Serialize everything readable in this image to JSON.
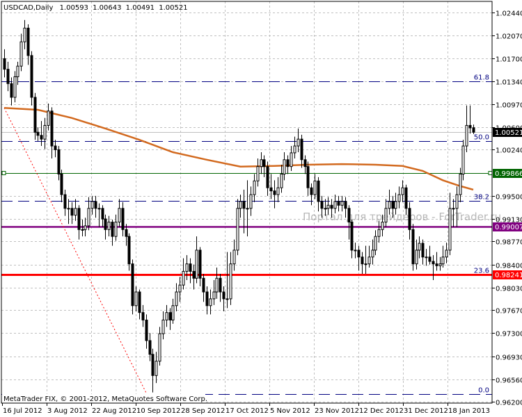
{
  "header": {
    "symbol_period": "USDCAD,Daily",
    "open": "1.00593",
    "high": "1.00643",
    "low": "1.00491",
    "close": "1.00521"
  },
  "copyright": "MetaTrader FIX, © 2001-2012, MetaQuotes Software Corp.",
  "watermark": "Портал для трейдеров - ForTrader.ru",
  "colors": {
    "background": "#ffffff",
    "grid": "#c0c0c0",
    "bull_body": "#ffffff",
    "bear_body": "#000000",
    "ma": "#d2691e",
    "fibo": "#000080",
    "trendline": "#ff0000",
    "level_green": "#006400",
    "level_purple": "#800080",
    "level_red": "#ff0000",
    "current_price": "#000000",
    "current_line": "#c0c0c0"
  },
  "chart_data": {
    "type": "candlestick",
    "title": "USDCAD,Daily",
    "ylim": [
      0.96178,
      1.02618
    ],
    "y_ticks": [
      "1.02440",
      "1.02070",
      "1.01700",
      "1.01340",
      "1.00970",
      "1.00600",
      "1.00240",
      "0.99500",
      "0.99130",
      "0.98770",
      "0.98400",
      "0.98030",
      "0.97670",
      "0.97300",
      "0.96930",
      "0.96560",
      "0.96200"
    ],
    "x_tick_labels": [
      "16 Jul 2012",
      "3 Aug 2012",
      "22 Aug 2012",
      "10 Sep 2012",
      "28 Sep 2012",
      "17 Oct 2012",
      "5 Nov 2012",
      "23 Nov 2012",
      "12 Dec 2012",
      "31 Dec 2012",
      "18 Jan 2013"
    ],
    "grid": true,
    "ohlc": [
      [
        1.017,
        1.0185,
        1.014,
        1.0153
      ],
      [
        1.0153,
        1.0165,
        1.0118,
        1.013
      ],
      [
        1.013,
        1.014,
        1.0095,
        1.0108
      ],
      [
        1.0108,
        1.015,
        1.01,
        1.0141
      ],
      [
        1.0141,
        1.0165,
        1.0128,
        1.0158
      ],
      [
        1.0158,
        1.021,
        1.015,
        1.0197
      ],
      [
        1.0197,
        1.0232,
        1.0185,
        1.0219
      ],
      [
        1.0219,
        1.0225,
        1.016,
        1.0175
      ],
      [
        1.0175,
        1.0182,
        1.0095,
        1.0108
      ],
      [
        1.0108,
        1.0115,
        1.004,
        1.0052
      ],
      [
        1.0052,
        1.006,
        1.0038,
        1.0047
      ],
      [
        1.0047,
        1.007,
        1.003,
        1.0041
      ],
      [
        1.0041,
        1.0075,
        1.0025,
        1.0063
      ],
      [
        1.0063,
        1.0098,
        1.0055,
        1.0086
      ],
      [
        1.0086,
        1.0092,
        1.001,
        1.003
      ],
      [
        1.003,
        1.004,
        1.0012,
        1.0024
      ],
      [
        1.0024,
        1.003,
        0.9975,
        0.9985
      ],
      [
        0.9985,
        0.9992,
        0.994,
        0.9952
      ],
      [
        0.9952,
        0.996,
        0.9918,
        0.993
      ],
      [
        0.993,
        0.9945,
        0.9905,
        0.993
      ],
      [
        0.993,
        0.994,
        0.9905,
        0.9919
      ],
      [
        0.9919,
        0.9945,
        0.991,
        0.993
      ],
      [
        0.993,
        0.9935,
        0.988,
        0.9896
      ],
      [
        0.9896,
        0.9912,
        0.9885,
        0.9896
      ],
      [
        0.9896,
        0.9915,
        0.9885,
        0.9902
      ],
      [
        0.9902,
        0.9948,
        0.9895,
        0.993
      ],
      [
        0.993,
        0.995,
        0.992,
        0.9941
      ],
      [
        0.9941,
        0.995,
        0.9915,
        0.993
      ],
      [
        0.993,
        0.9938,
        0.99,
        0.993
      ],
      [
        0.993,
        0.9935,
        0.99,
        0.9913
      ],
      [
        0.9913,
        0.992,
        0.988,
        0.9896
      ],
      [
        0.9896,
        0.9918,
        0.9885,
        0.9908
      ],
      [
        0.9908,
        0.9912,
        0.987,
        0.9885
      ],
      [
        0.9885,
        0.992,
        0.9878,
        0.9908
      ],
      [
        0.9908,
        0.9945,
        0.99,
        0.993
      ],
      [
        0.993,
        0.994,
        0.9885,
        0.9896
      ],
      [
        0.9896,
        0.9905,
        0.987,
        0.9885
      ],
      [
        0.9885,
        0.989,
        0.983,
        0.9841
      ],
      [
        0.9841,
        0.9848,
        0.976,
        0.9774
      ],
      [
        0.9774,
        0.9805,
        0.9765,
        0.9796
      ],
      [
        0.9796,
        0.98,
        0.9752,
        0.9763
      ],
      [
        0.9763,
        0.9775,
        0.974,
        0.9751
      ],
      [
        0.9751,
        0.976,
        0.9705,
        0.9718
      ],
      [
        0.9718,
        0.973,
        0.9685,
        0.9696
      ],
      [
        0.9696,
        0.9705,
        0.9635,
        0.9662
      ],
      [
        0.9662,
        0.97,
        0.965,
        0.9685
      ],
      [
        0.9685,
        0.974,
        0.9678,
        0.9729
      ],
      [
        0.9729,
        0.9765,
        0.972,
        0.9751
      ],
      [
        0.9751,
        0.9775,
        0.974,
        0.9763
      ],
      [
        0.9763,
        0.977,
        0.9735,
        0.9751
      ],
      [
        0.9751,
        0.9785,
        0.9745,
        0.9774
      ],
      [
        0.9774,
        0.981,
        0.9765,
        0.9796
      ],
      [
        0.9796,
        0.982,
        0.978,
        0.9807
      ],
      [
        0.9807,
        0.985,
        0.98,
        0.9829
      ],
      [
        0.9829,
        0.9855,
        0.9815,
        0.9841
      ],
      [
        0.9841,
        0.985,
        0.981,
        0.9829
      ],
      [
        0.9829,
        0.984,
        0.98,
        0.9818
      ],
      [
        0.9818,
        0.9885,
        0.981,
        0.9863
      ],
      [
        0.9863,
        0.9868,
        0.9805,
        0.9818
      ],
      [
        0.9818,
        0.9825,
        0.978,
        0.9796
      ],
      [
        0.9796,
        0.9805,
        0.976,
        0.9774
      ],
      [
        0.9774,
        0.98,
        0.976,
        0.9785
      ],
      [
        0.9785,
        0.9815,
        0.9775,
        0.9796
      ],
      [
        0.9796,
        0.9835,
        0.9785,
        0.9818
      ],
      [
        0.9818,
        0.9825,
        0.978,
        0.9796
      ],
      [
        0.9796,
        0.9805,
        0.9765,
        0.9785
      ],
      [
        0.9785,
        0.986,
        0.977,
        0.9785
      ],
      [
        0.9785,
        0.986,
        0.9775,
        0.9841
      ],
      [
        0.9841,
        0.988,
        0.983,
        0.9863
      ],
      [
        0.9863,
        0.9945,
        0.9855,
        0.993
      ],
      [
        0.993,
        0.9952,
        0.9915,
        0.9941
      ],
      [
        0.9941,
        0.996,
        0.989,
        0.993
      ],
      [
        0.993,
        0.9975,
        0.9885,
        0.993
      ],
      [
        0.993,
        0.9965,
        0.9918,
        0.9952
      ],
      [
        0.9952,
        0.9985,
        0.994,
        0.9974
      ],
      [
        0.9974,
        1.001,
        0.9965,
        0.9997
      ],
      [
        0.9997,
        1.002,
        0.9985,
        1.0008
      ],
      [
        1.0008,
        1.0015,
        0.998,
        0.9997
      ],
      [
        0.9997,
        1.0005,
        0.995,
        0.9963
      ],
      [
        0.9963,
        0.9985,
        0.9945,
        0.9958
      ],
      [
        0.9958,
        0.9975,
        0.993,
        0.9952
      ],
      [
        0.9952,
        0.998,
        0.994,
        0.9963
      ],
      [
        0.9963,
        1.0,
        0.9955,
        0.9985
      ],
      [
        0.9985,
        1.002,
        0.9975,
        1.0008
      ],
      [
        1.0008,
        1.0015,
        0.9985,
        0.9997
      ],
      [
        0.9997,
        1.003,
        0.999,
        1.0019
      ],
      [
        1.0019,
        1.0045,
        1.001,
        1.003
      ],
      [
        1.003,
        1.0058,
        1.002,
        1.0041
      ],
      [
        1.0041,
        1.0048,
        0.9995,
        1.0008
      ],
      [
        1.0008,
        1.0015,
        0.9985,
        0.9997
      ],
      [
        0.9997,
        1.0005,
        0.995,
        0.9963
      ],
      [
        0.9963,
        0.997,
        0.9935,
        0.9952
      ],
      [
        0.9952,
        0.9985,
        0.9945,
        0.9974
      ],
      [
        0.9974,
        0.998,
        0.9925,
        0.9941
      ],
      [
        0.9941,
        0.995,
        0.9915,
        0.993
      ],
      [
        0.993,
        0.9945,
        0.9918,
        0.993
      ],
      [
        0.993,
        0.9948,
        0.992,
        0.9935
      ],
      [
        0.9935,
        0.9945,
        0.9915,
        0.993
      ],
      [
        0.993,
        0.9952,
        0.9922,
        0.9941
      ],
      [
        0.9941,
        0.995,
        0.9925,
        0.9935
      ],
      [
        0.9935,
        0.995,
        0.9925,
        0.9941
      ],
      [
        0.9941,
        0.9948,
        0.9915,
        0.993
      ],
      [
        0.993,
        0.9935,
        0.988,
        0.9908
      ],
      [
        0.9908,
        0.9912,
        0.985,
        0.9863
      ],
      [
        0.9863,
        0.9875,
        0.985,
        0.9863
      ],
      [
        0.9863,
        0.987,
        0.983,
        0.9852
      ],
      [
        0.9852,
        0.986,
        0.9825,
        0.9841
      ],
      [
        0.9841,
        0.987,
        0.9825,
        0.9841
      ],
      [
        0.9841,
        0.987,
        0.9835,
        0.9852
      ],
      [
        0.9852,
        0.988,
        0.984,
        0.9863
      ],
      [
        0.9863,
        0.9895,
        0.9855,
        0.9885
      ],
      [
        0.9885,
        0.991,
        0.9875,
        0.9896
      ],
      [
        0.9896,
        0.992,
        0.9885,
        0.9908
      ],
      [
        0.9908,
        0.9945,
        0.99,
        0.993
      ],
      [
        0.993,
        0.996,
        0.992,
        0.9941
      ],
      [
        0.9941,
        0.995,
        0.9915,
        0.993
      ],
      [
        0.993,
        0.9955,
        0.992,
        0.9941
      ],
      [
        0.9941,
        0.9965,
        0.993,
        0.9952
      ],
      [
        0.9952,
        0.9975,
        0.994,
        0.9963
      ],
      [
        0.9963,
        0.9968,
        0.992,
        0.993
      ],
      [
        0.993,
        0.994,
        0.988,
        0.9896
      ],
      [
        0.9896,
        0.9905,
        0.983,
        0.9841
      ],
      [
        0.9841,
        0.988,
        0.9832,
        0.9863
      ],
      [
        0.9863,
        0.9885,
        0.985,
        0.9874
      ],
      [
        0.9874,
        0.988,
        0.984,
        0.9852
      ],
      [
        0.9852,
        0.9865,
        0.9838,
        0.9852
      ],
      [
        0.9852,
        0.987,
        0.984,
        0.9845
      ],
      [
        0.9845,
        0.9855,
        0.9815,
        0.9841
      ],
      [
        0.9841,
        0.986,
        0.983,
        0.9838
      ],
      [
        0.9838,
        0.9852,
        0.983,
        0.9841
      ],
      [
        0.9841,
        0.987,
        0.9835,
        0.9852
      ],
      [
        0.9852,
        0.9875,
        0.9842,
        0.9863
      ],
      [
        0.9863,
        0.9955,
        0.9855,
        0.993
      ],
      [
        0.993,
        0.9945,
        0.99,
        0.993
      ],
      [
        0.993,
        0.9965,
        0.99,
        0.9952
      ],
      [
        0.9952,
        0.9995,
        0.994,
        0.9985
      ],
      [
        0.9985,
        1.004,
        0.9975,
        1.003
      ],
      [
        1.003,
        1.0095,
        1.002,
        1.0063
      ],
      [
        1.0063,
        1.0095,
        1.005,
        1.0059
      ],
      [
        1.00593,
        1.00643,
        1.00491,
        1.00521
      ]
    ],
    "moving_average": [
      [
        0,
        1.0091
      ],
      [
        10,
        1.0088
      ],
      [
        20,
        1.0075
      ],
      [
        30,
        1.0058
      ],
      [
        40,
        1.004
      ],
      [
        50,
        1.002
      ],
      [
        60,
        1.0008
      ],
      [
        70,
        0.9997
      ],
      [
        80,
        0.9998
      ],
      [
        90,
        1.0
      ],
      [
        100,
        1.0001
      ],
      [
        110,
        1.0
      ],
      [
        118,
        0.9998
      ],
      [
        124,
        0.999
      ],
      [
        130,
        0.9975
      ],
      [
        135,
        0.9966
      ],
      [
        139,
        0.996
      ]
    ],
    "trendline": {
      "from": [
        0,
        1.0091
      ],
      "to": [
        42,
        0.9635
      ]
    },
    "fibo_levels": [
      {
        "label": "61.8",
        "price": 1.0134
      },
      {
        "label": "50.0",
        "price": 1.0038
      },
      {
        "label": "38.2",
        "price": 0.9942
      },
      {
        "label": "23.6",
        "price": 0.9824
      },
      {
        "label": "0.0",
        "price": 0.9632
      }
    ],
    "horizontal_levels": [
      {
        "label": "0.99866",
        "price": 0.99866,
        "color": "#006400",
        "name": "green"
      },
      {
        "label": "0.99007",
        "price": 0.99007,
        "color": "#800080",
        "name": "purple"
      },
      {
        "label": "0.98241",
        "price": 0.98241,
        "color": "#ff0000",
        "name": "red"
      }
    ],
    "current_price": {
      "label": "1.00521",
      "price": 1.00521
    }
  }
}
